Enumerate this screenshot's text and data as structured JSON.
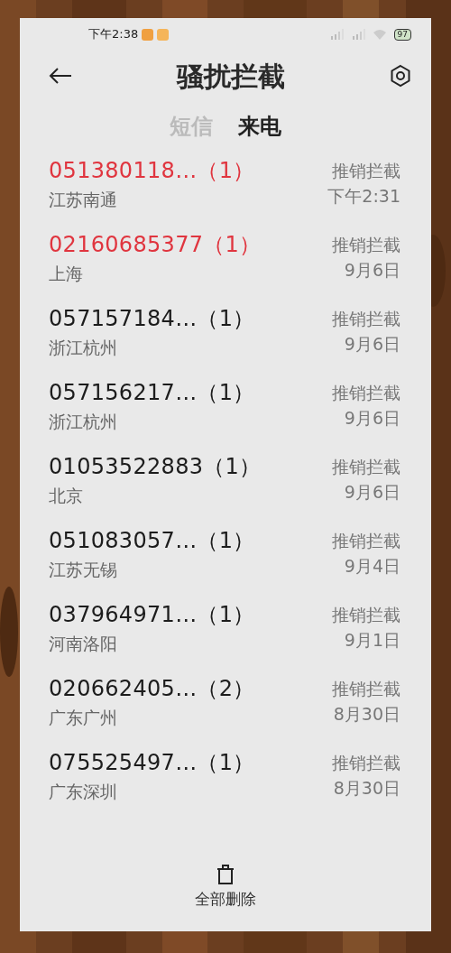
{
  "status_bar": {
    "time": "下午2:38",
    "battery": "97"
  },
  "title": "骚扰拦截",
  "tabs": [
    {
      "label": "短信",
      "selected": false
    },
    {
      "label": "来电",
      "selected": true
    }
  ],
  "calls": [
    {
      "number": "051380118…",
      "count": "（1）",
      "location": "江苏南通",
      "tag": "推销拦截",
      "time": "下午2:31",
      "new": true
    },
    {
      "number": "02160685377",
      "count": "（1）",
      "location": "上海",
      "tag": "推销拦截",
      "time": "9月6日",
      "new": true
    },
    {
      "number": "057157184…",
      "count": "（1）",
      "location": "浙江杭州",
      "tag": "推销拦截",
      "time": "9月6日",
      "new": false
    },
    {
      "number": "057156217…",
      "count": "（1）",
      "location": "浙江杭州",
      "tag": "推销拦截",
      "time": "9月6日",
      "new": false
    },
    {
      "number": "01053522883",
      "count": "（1）",
      "location": "北京",
      "tag": "推销拦截",
      "time": "9月6日",
      "new": false
    },
    {
      "number": "051083057…",
      "count": "（1）",
      "location": "江苏无锡",
      "tag": "推销拦截",
      "time": "9月4日",
      "new": false
    },
    {
      "number": "037964971…",
      "count": "（1）",
      "location": "河南洛阳",
      "tag": "推销拦截",
      "time": "9月1日",
      "new": false
    },
    {
      "number": "020662405…",
      "count": "（2）",
      "location": "广东广州",
      "tag": "推销拦截",
      "time": "8月30日",
      "new": false
    },
    {
      "number": "075525497…",
      "count": "（1）",
      "location": "广东深圳",
      "tag": "推销拦截",
      "time": "8月30日",
      "new": false
    }
  ],
  "delete_all": "全部删除"
}
